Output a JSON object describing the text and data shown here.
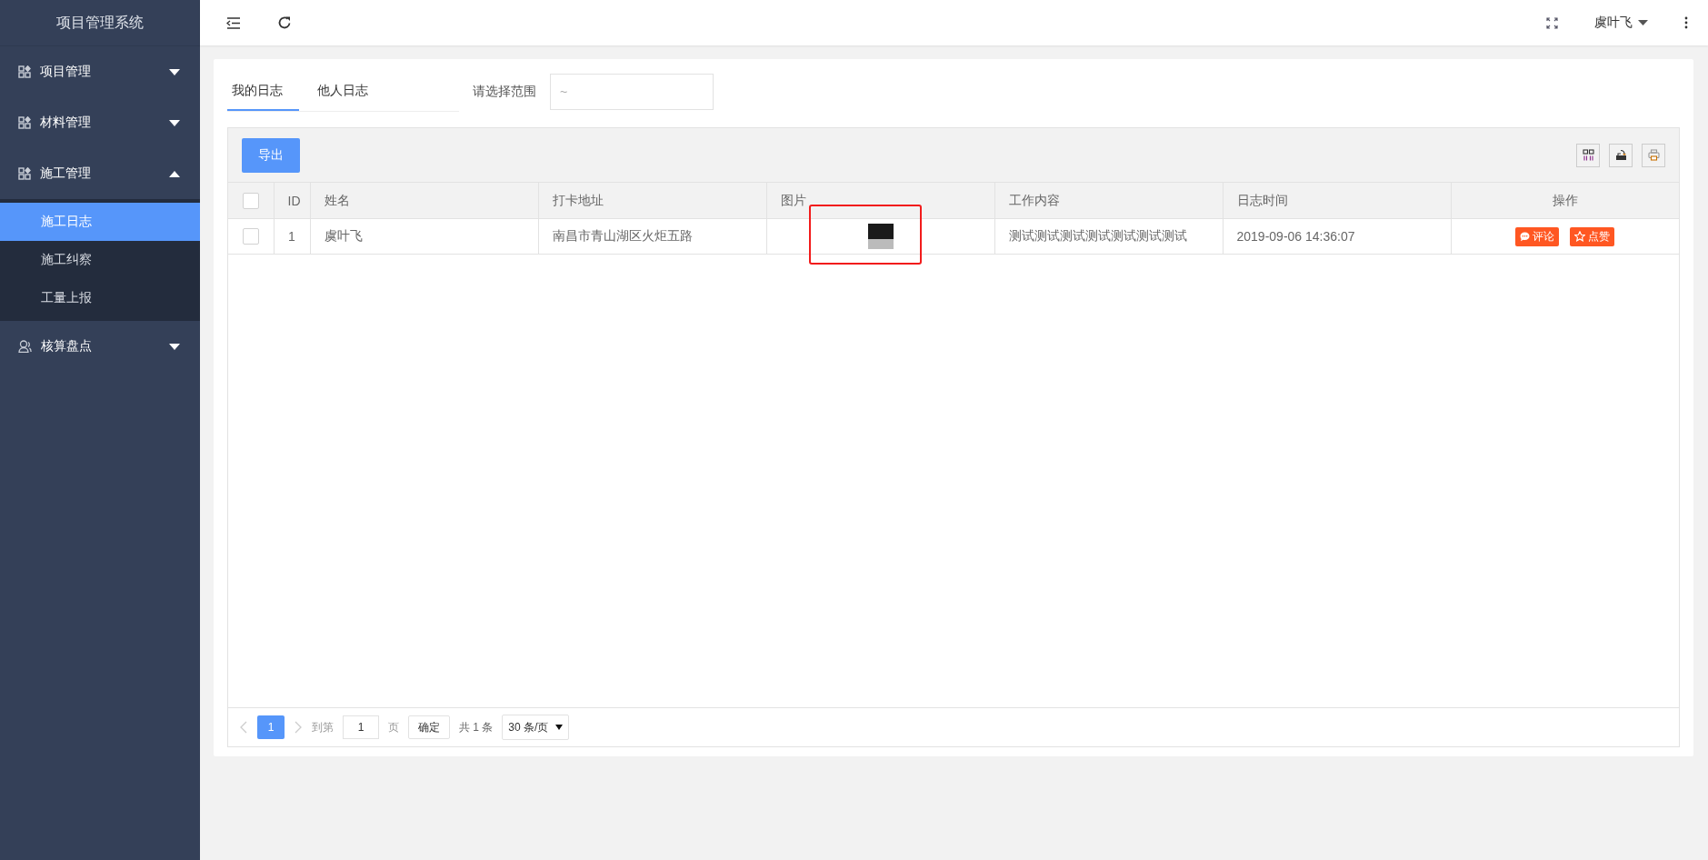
{
  "sidebar": {
    "title": "项目管理系统",
    "menus": [
      {
        "label": "项目管理",
        "kind": "module",
        "expanded": false
      },
      {
        "label": "材料管理",
        "kind": "module",
        "expanded": false
      },
      {
        "label": "施工管理",
        "kind": "module",
        "expanded": true,
        "children": [
          {
            "label": "施工日志",
            "selected": true
          },
          {
            "label": "施工纠察",
            "selected": false
          },
          {
            "label": "工量上报",
            "selected": false
          }
        ]
      },
      {
        "label": "核算盘点",
        "kind": "people",
        "expanded": false
      }
    ]
  },
  "header": {
    "user": "虞叶飞"
  },
  "tabs": [
    {
      "label": "我的日志",
      "selected": true
    },
    {
      "label": "他人日志",
      "selected": false
    }
  ],
  "range": {
    "label": "请选择范围",
    "placeholder": "~"
  },
  "toolbar": {
    "export_button": "导出"
  },
  "table": {
    "columns": [
      "ID",
      "姓名",
      "打卡地址",
      "图片",
      "工作内容",
      "日志时间",
      "操作"
    ],
    "header_checked": false,
    "rows": [
      {
        "checked": false,
        "id": "1",
        "name": "虞叶飞",
        "address": "南昌市青山湖区火炬五路",
        "content": "测试测试测试测试测试测试测试",
        "time": "2019-09-06 14:36:07",
        "actions": [
          {
            "kind": "comment",
            "label": "评论"
          },
          {
            "kind": "like",
            "label": "点赞"
          }
        ]
      }
    ]
  },
  "pagination": {
    "pages": [
      {
        "label": "1",
        "selected": true
      }
    ],
    "goto_label": "到第",
    "goto_value": "1",
    "page_unit": "页",
    "confirm": "确定",
    "total": "共 1 条",
    "page_size": "30 条/页"
  }
}
